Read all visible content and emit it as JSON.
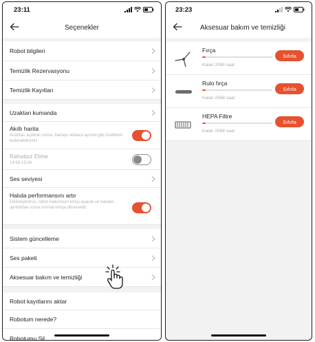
{
  "left": {
    "time": "23:11",
    "title": "Seçenekler",
    "rows_a": [
      {
        "label": "Robot bilgileri"
      },
      {
        "label": "Temizlik Rezervasyonu"
      },
      {
        "label": "Temizlik Kayıtları"
      }
    ],
    "remote": "Uzaktan kumanda",
    "smart_map": {
      "label": "Akıllı harita",
      "desc": "Anahtarı açtıktan sonra, haritayı odalara ayırma gibi özellikleri kullanabilirsiniz",
      "enabled": true
    },
    "dnd": {
      "label": "Rahatsız Etme",
      "desc": "14:58-15:06",
      "enabled": false
    },
    "volume": "Ses seviyesi",
    "carpet": {
      "label": "Halıda performansını artır",
      "desc": "Etkinleştirilirse, robot maksimum emişi açacak ve halıdan ayrıldıktan sonra normal emişe dönecektir.",
      "enabled": true
    },
    "rows_b": [
      {
        "label": "Sistem güncelleme"
      },
      {
        "label": "Ses paketi"
      },
      {
        "label": "Aksesuar bakım ve temizliği"
      }
    ],
    "rows_c": [
      {
        "label": "Robot kayıtlarını aktar"
      },
      {
        "label": "Robotum nerede?"
      },
      {
        "label": "Robotumu Sil"
      }
    ]
  },
  "right": {
    "time": "23:23",
    "title": "Aksesuar bakım ve temizliği",
    "accessories": [
      {
        "name": "Fırça",
        "remaining": "Kalan 2068 saat",
        "button": "Sıfırla",
        "icon": "side-brush-icon",
        "level": 0.05
      },
      {
        "name": "Rulo fırça",
        "remaining": "Kalan 2068 saat",
        "button": "Sıfırla",
        "icon": "roller-brush-icon",
        "level": 0.05
      },
      {
        "name": "HEPA Filtre",
        "remaining": "Kalan 2068 saat",
        "button": "Sıfırla",
        "icon": "hepa-filter-icon",
        "level": 0.05
      }
    ]
  },
  "colors": {
    "accent": "#e6512f",
    "background": "#f2f2f2"
  }
}
